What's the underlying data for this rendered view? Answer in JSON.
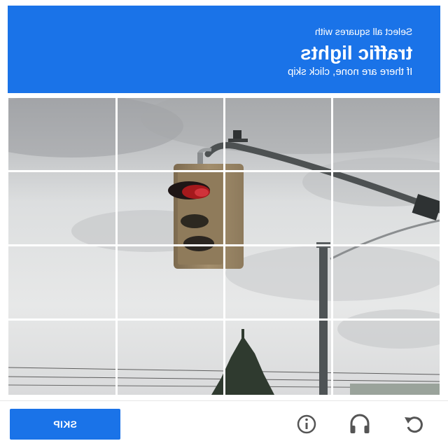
{
  "header": {
    "instruction_line1": "Select all squares with",
    "instruction_target": "traffic lights",
    "instruction_line3": "If there are none, click skip"
  },
  "grid": {
    "rows": 4,
    "cols": 4
  },
  "footer": {
    "skip_label": "SKIP",
    "icons": [
      "reload-icon",
      "audio-icon",
      "info-icon"
    ]
  },
  "colors": {
    "accent": "#1a73e8",
    "text_on_accent": "#ffffff",
    "icon": "#555555"
  }
}
